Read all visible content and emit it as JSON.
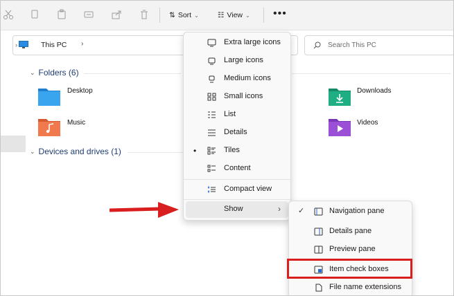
{
  "toolbar": {
    "icons": [
      "cut-icon",
      "copy-icon",
      "paste-icon",
      "rename-icon",
      "share-icon",
      "delete-icon"
    ],
    "sort_label": "Sort",
    "view_label": "View",
    "more_label": "•••"
  },
  "address": {
    "crumb": "This PC",
    "chevron": "›"
  },
  "search": {
    "placeholder": "Search This PC"
  },
  "folders": {
    "header": "Folders (6)",
    "items": [
      {
        "label": "Desktop",
        "color": "#2f9be8"
      },
      {
        "label": "Downloads",
        "color": "#1fae84"
      },
      {
        "label": "Music",
        "color": "#f07a4d"
      },
      {
        "label": "Videos",
        "color": "#9b4fd6"
      }
    ]
  },
  "drives": {
    "header": "Devices and drives (1)"
  },
  "view_menu": {
    "items": [
      {
        "label": "Extra large icons",
        "icon": "monitor-icon"
      },
      {
        "label": "Large icons",
        "icon": "monitor-icon"
      },
      {
        "label": "Medium icons",
        "icon": "monitor-icon"
      },
      {
        "label": "Small icons",
        "icon": "grid-icon"
      },
      {
        "label": "List",
        "icon": "list-icon"
      },
      {
        "label": "Details",
        "icon": "details-icon"
      },
      {
        "label": "Tiles",
        "icon": "tiles-icon",
        "selected": true
      },
      {
        "label": "Content",
        "icon": "content-icon"
      },
      {
        "label": "Compact view",
        "icon": "compact-icon"
      },
      {
        "label": "Show",
        "icon": "",
        "submenu": true
      }
    ],
    "selected_marker": "•",
    "submenu_arrow": "›"
  },
  "show_menu": {
    "items": [
      {
        "label": "Navigation pane",
        "checked": true
      },
      {
        "label": "Details pane",
        "checked": false
      },
      {
        "label": "Preview pane",
        "checked": false
      },
      {
        "label": "Item check boxes",
        "checked": false
      },
      {
        "label": "File name extensions",
        "checked": false
      }
    ],
    "check_mark": "✓"
  },
  "colors": {
    "highlight": "#d81e1e",
    "section_header": "#1f3c73"
  }
}
